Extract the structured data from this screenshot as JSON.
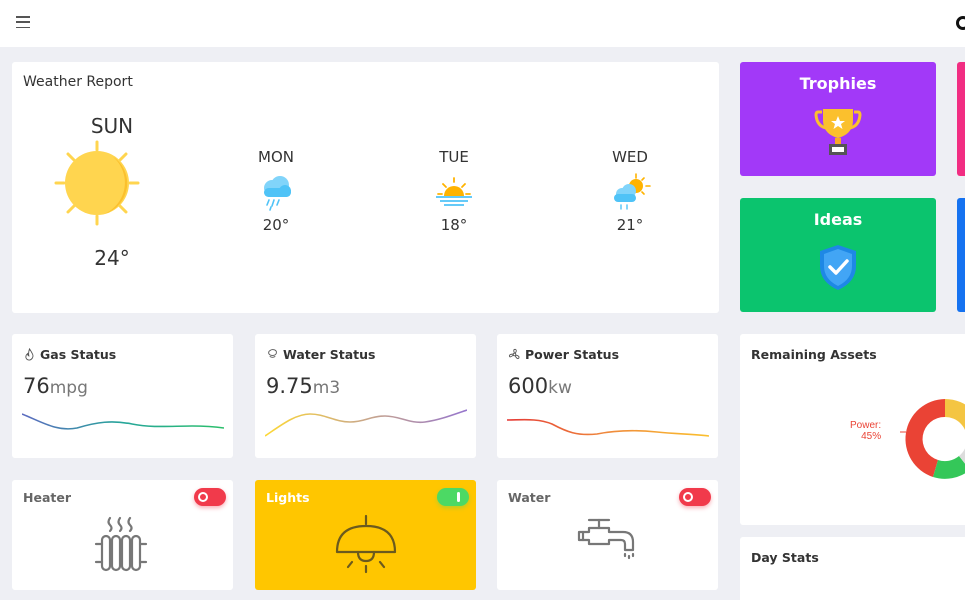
{
  "weather": {
    "title": "Weather Report",
    "today": {
      "day": "SUN",
      "temp": "24°"
    },
    "forecast": [
      {
        "day": "MON",
        "temp": "20°",
        "icon": "rain-cloud-icon"
      },
      {
        "day": "TUE",
        "temp": "18°",
        "icon": "sunset-icon"
      },
      {
        "day": "WED",
        "temp": "21°",
        "icon": "partly-cloudy-icon"
      }
    ]
  },
  "tiles": {
    "trophies": {
      "title": "Trophies",
      "color": "#a239f8",
      "icon": "trophy-icon"
    },
    "ideas": {
      "title": "Ideas",
      "color": "#0bc46e",
      "icon": "shield-check-icon"
    }
  },
  "status": {
    "gas": {
      "title": "Gas Status",
      "value": "76",
      "unit": "mpg"
    },
    "water": {
      "title": "Water Status",
      "value": "9.75",
      "unit": "m3"
    },
    "power": {
      "title": "Power Status",
      "value": "600",
      "unit": "kw"
    }
  },
  "controls": {
    "heater": {
      "title": "Heater",
      "state": "off"
    },
    "lights": {
      "title": "Lights",
      "state": "on"
    },
    "water": {
      "title": "Water",
      "state": "off"
    }
  },
  "assets": {
    "title": "Remaining Assets",
    "power_label": "Power:",
    "power_pct": "45%"
  },
  "day_stats": {
    "title": "Day Stats"
  }
}
